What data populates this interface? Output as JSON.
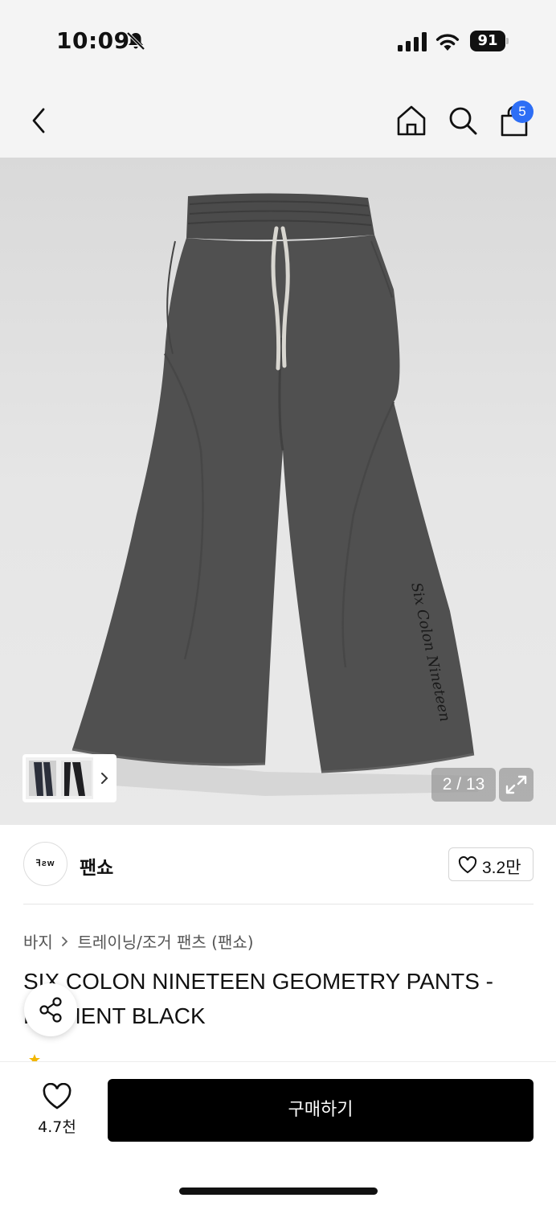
{
  "status_bar": {
    "time": "10:09",
    "battery": "91",
    "icons": [
      "bell-slash-icon",
      "cellular-signal-icon",
      "wifi-icon",
      "battery-icon"
    ]
  },
  "nav": {
    "icons": [
      "back-chevron-icon",
      "home-icon",
      "search-icon",
      "shopping-bag-icon"
    ],
    "cart_badge": "5",
    "accent_color": "#2d6ef5"
  },
  "gallery": {
    "page_indicator": "2 / 13",
    "image_print": "Six Colon Nineteen",
    "icons": [
      "chevron-right-icon",
      "expand-icon"
    ]
  },
  "brand": {
    "logo_text": "ꟻƨw",
    "name": "팬쇼",
    "wish_count": "3.2만"
  },
  "breadcrumb": {
    "category": "바지",
    "subcategory": "트레이닝/조거 팬츠 (팬쇼)"
  },
  "product": {
    "title": "SIX COLON NINETEEN GEOMETRY PANTS - PIGMENT BLACK"
  },
  "bottom_bar": {
    "like_count": "4.7천",
    "buy_label": "구매하기"
  }
}
